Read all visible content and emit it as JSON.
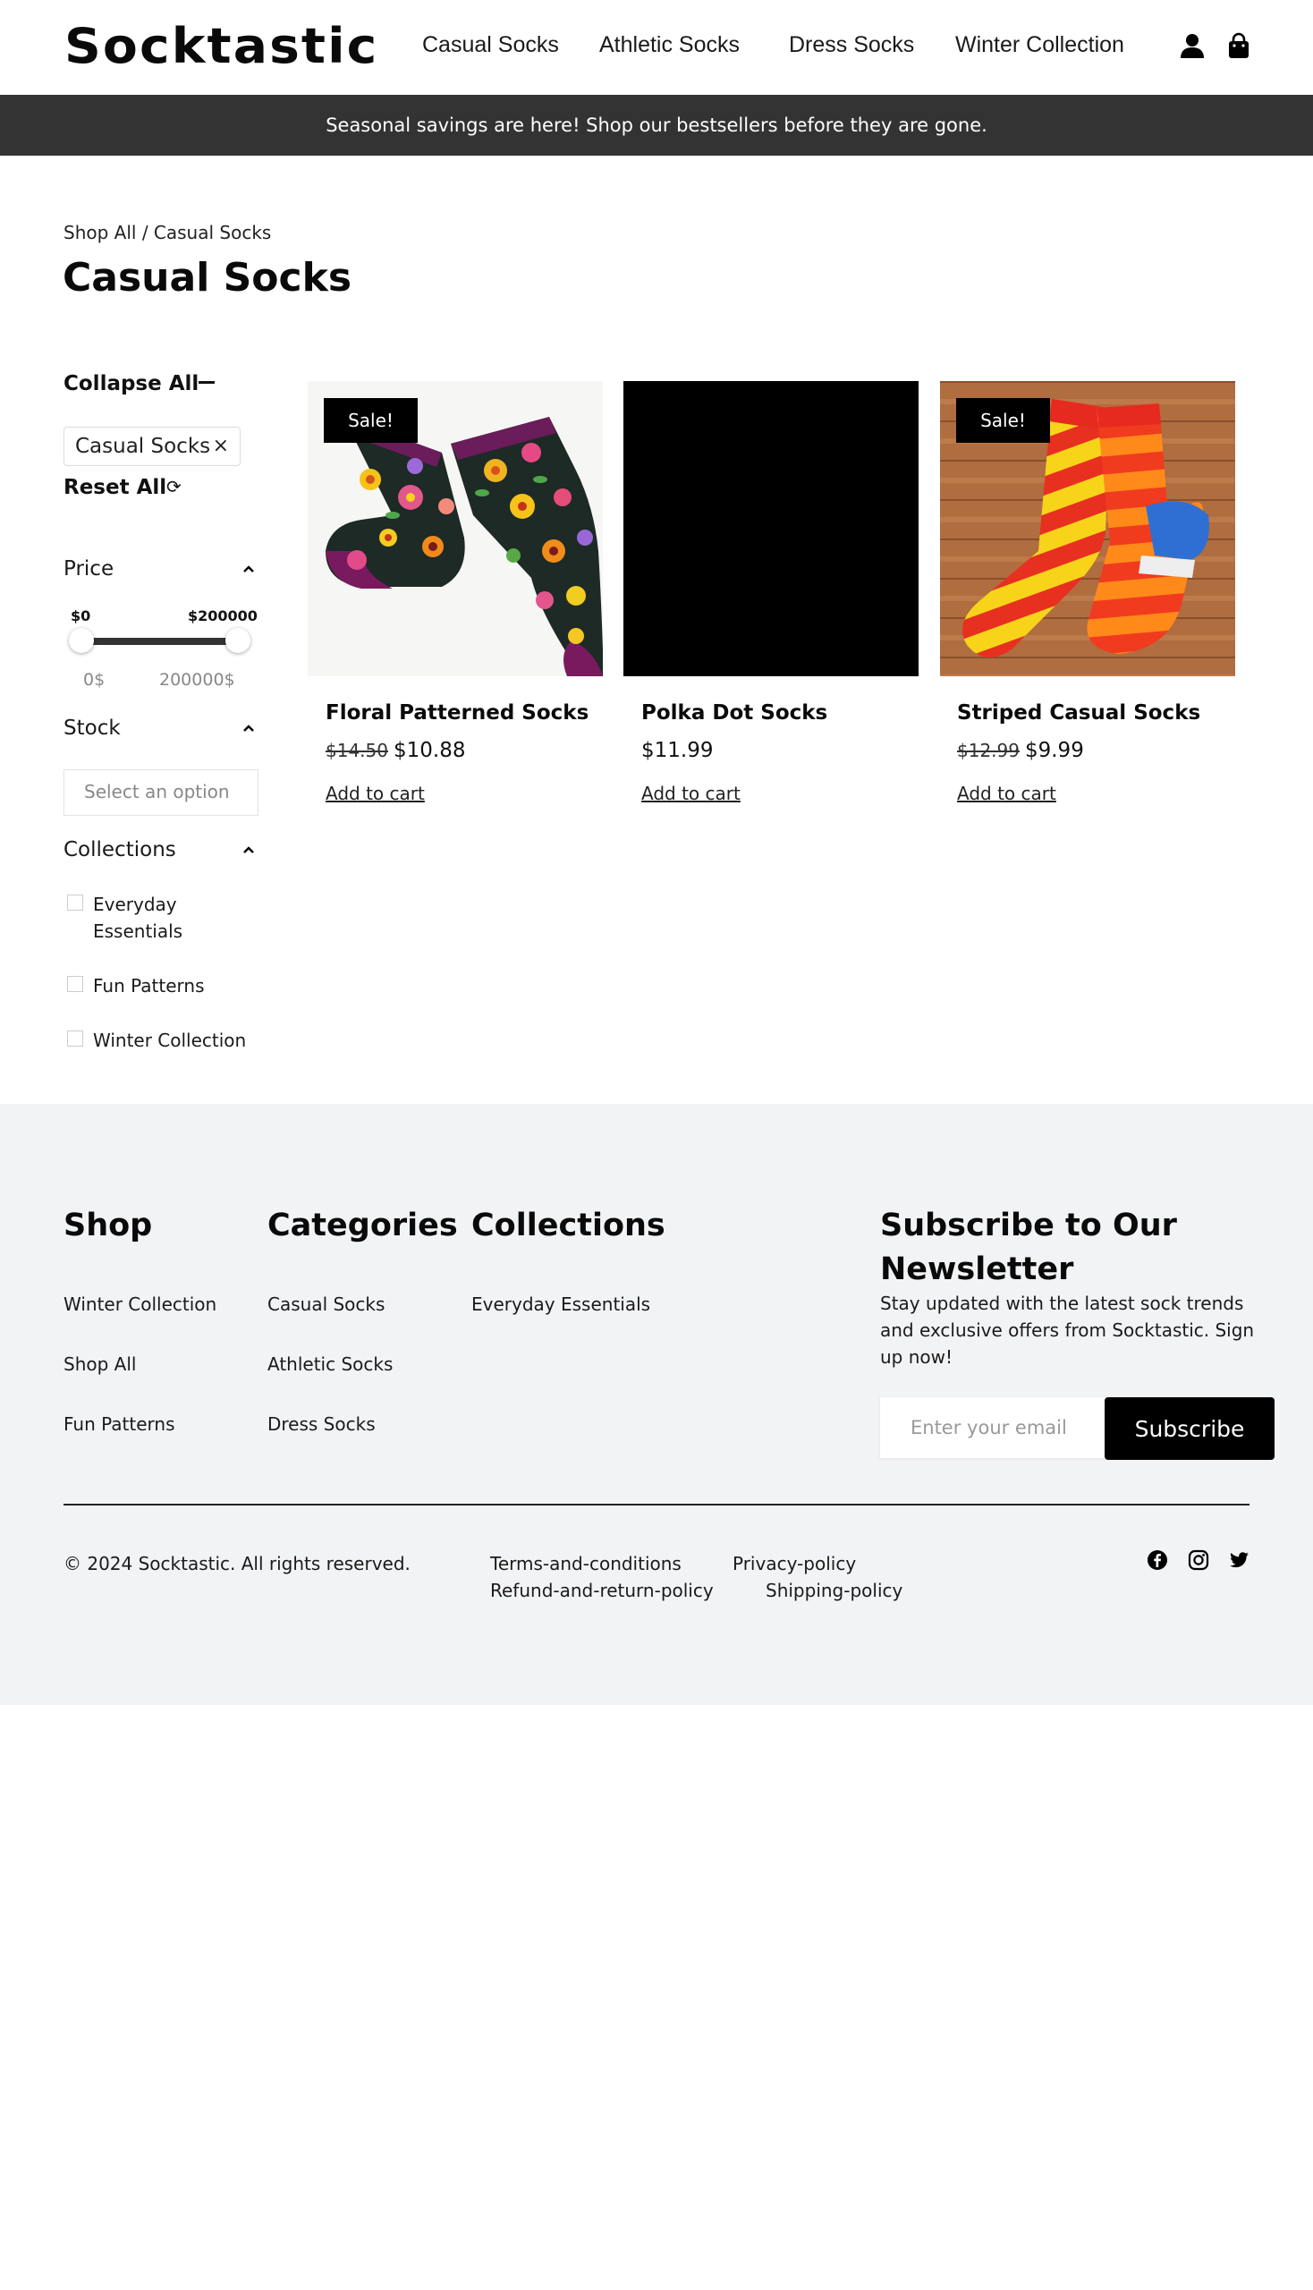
{
  "header": {
    "logo": "Socktastic",
    "nav": [
      "Casual Socks",
      "Athletic Socks",
      "Dress Socks",
      "Winter Collection"
    ],
    "icons": [
      "account-icon",
      "shopping-bag-icon"
    ]
  },
  "banner": {
    "text": "Seasonal savings are here! Shop our bestsellers before they are gone."
  },
  "breadcrumb": {
    "text": "Shop All / Casual Socks"
  },
  "page": {
    "title": "Casual Socks"
  },
  "sidebar": {
    "collapse_all": "Collapse All",
    "active_filter": "Casual Socks",
    "remove_icon": "×",
    "reset_all": "Reset All",
    "reset_icon": "⟳",
    "price": {
      "heading": "Price",
      "min_label": "$0",
      "max_label": "$200000",
      "min_value": "0$",
      "max_value": "200000$",
      "range_min": 0,
      "range_max": 200000
    },
    "stock": {
      "heading": "Stock",
      "placeholder": "Select an option"
    },
    "collections": {
      "heading": "Collections",
      "items": [
        "Everyday Essentials",
        "Fun Patterns",
        "Winter Collection"
      ]
    }
  },
  "products": [
    {
      "name": "Floral Patterned Socks",
      "old_price": "$14.50",
      "price": "$10.88",
      "sale_label": "Sale!",
      "cta": "Add to cart"
    },
    {
      "name": "Polka Dot Socks",
      "old_price": "",
      "price": "$11.99",
      "sale_label": "",
      "cta": "Add to cart"
    },
    {
      "name": "Striped Casual Socks",
      "old_price": "$12.99",
      "price": "$9.99",
      "sale_label": "Sale!",
      "cta": "Add to cart"
    }
  ],
  "footer": {
    "shop": {
      "heading": "Shop",
      "links": [
        "Winter Collection",
        "Shop All",
        "Fun Patterns"
      ]
    },
    "categories": {
      "heading": "Categories",
      "links": [
        "Casual Socks",
        "Athletic Socks",
        "Dress Socks"
      ]
    },
    "collections": {
      "heading": "Collections",
      "links": [
        "Everyday Essentials"
      ]
    },
    "newsletter": {
      "heading_line1": "Subscribe to Our",
      "heading_line2": "Newsletter",
      "text": "Stay updated with the latest sock trends and exclusive offers from Socktastic. Sign up now!",
      "placeholder": "Enter your email",
      "button": "Subscribe"
    },
    "copyright": "© 2024 Socktastic. All rights reserved.",
    "legal": [
      "Terms-and-conditions",
      "Privacy-policy",
      "Refund-and-return-policy",
      "Shipping-policy"
    ],
    "social": [
      "facebook-icon",
      "instagram-icon",
      "twitter-icon"
    ]
  },
  "colors": {
    "banner_bg": "#333333",
    "footer_bg": "#f2f3f5",
    "badge_bg": "#000000",
    "button_bg": "#000000"
  }
}
